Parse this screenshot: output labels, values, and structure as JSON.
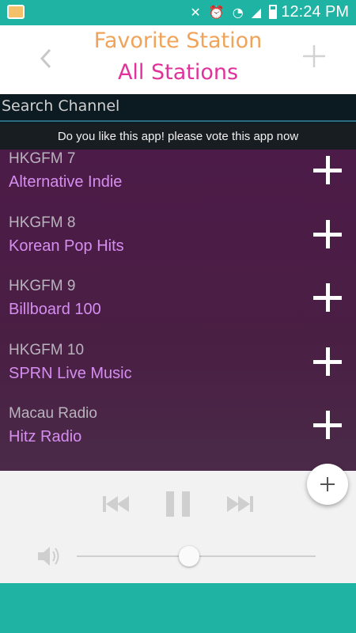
{
  "status_bar": {
    "time": "12:24 PM"
  },
  "header": {
    "title_primary": "Favorite Station",
    "title_secondary": "All Stations"
  },
  "search": {
    "placeholder": "Search Channel"
  },
  "banner": {
    "text": "Do you like this app! please vote this app now"
  },
  "stations": [
    {
      "station": "HKGFM 7",
      "genre": "Alternative Indie"
    },
    {
      "station": "HKGFM 8",
      "genre": "Korean Pop Hits"
    },
    {
      "station": "HKGFM 9",
      "genre": "Billboard 100"
    },
    {
      "station": "HKGFM 10",
      "genre": "SPRN Live Music"
    },
    {
      "station": "Macau Radio",
      "genre": "Hitz Radio"
    }
  ],
  "player": {
    "volume_level": 0.47
  },
  "colors": {
    "status_bar": "#1fb3a4",
    "title_primary": "#f0a35a",
    "title_secondary": "#e0329a",
    "list_background": "#4c1b48",
    "genre_text": "#d58ef0"
  },
  "icons": {
    "back": "back-chevron-icon",
    "add_header": "add-icon",
    "fab": "add-icon",
    "prev": "previous-track-icon",
    "pause": "pause-icon",
    "next": "next-track-icon",
    "volume": "volume-icon"
  }
}
